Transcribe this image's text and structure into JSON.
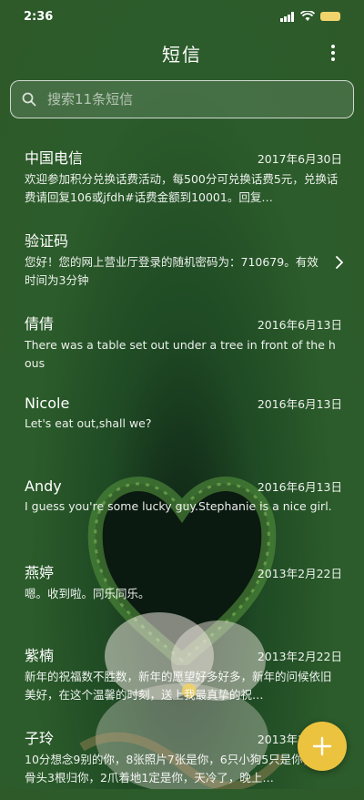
{
  "status": {
    "time": "2:36"
  },
  "header": {
    "title": "短信"
  },
  "search": {
    "placeholder": "搜索11条短信"
  },
  "messages": [
    {
      "name": "中国电信",
      "date": "2017年6月30日",
      "preview": "欢迎参加积分兑换话费活动，每500分可兑换话费5元，兑换话费请回复106或jfdh#话费金额到10001。回复…"
    },
    {
      "name": "验证码",
      "date": "",
      "preview": "您好！您的网上营业厅登录的随机密码为：710679。有效时间为3分钟"
    },
    {
      "name": "倩倩",
      "date": "2016年6月13日",
      "preview": "There was a table set out under a tree in front of the hous"
    },
    {
      "name": "Nicole",
      "date": "2016年6月13日",
      "preview": "Let's eat out,shall we?"
    },
    {
      "name": "Andy",
      "date": "2016年6月13日",
      "preview": "I guess you're some lucky guy.Stephanie is a nice girl."
    },
    {
      "name": "燕婷",
      "date": "2013年2月22日",
      "preview": "嗯。收到啦。同乐同乐。"
    },
    {
      "name": "紫楠",
      "date": "2013年2月22日",
      "preview": "新年的祝福数不胜数，新年的愿望好多好多，新年的问候依旧美好，在这个温馨的时刻，送上我最真挚的祝…"
    },
    {
      "name": "子玲",
      "date": "2013年2月22日",
      "preview": "10分想念9别的你，8张照片7张是你，6只小狗5只是你，4根骨头3根归你，2爪着地1定是你，天冷了，晚上…"
    }
  ],
  "colors": {
    "fab": "#ecc33f",
    "battery": "#f1d36b",
    "background": "#2e5a2a"
  },
  "icons": {
    "search": "search-icon",
    "more": "more-vertical-icon",
    "chevron": "chevron-right-icon",
    "fab": "plus-icon"
  }
}
